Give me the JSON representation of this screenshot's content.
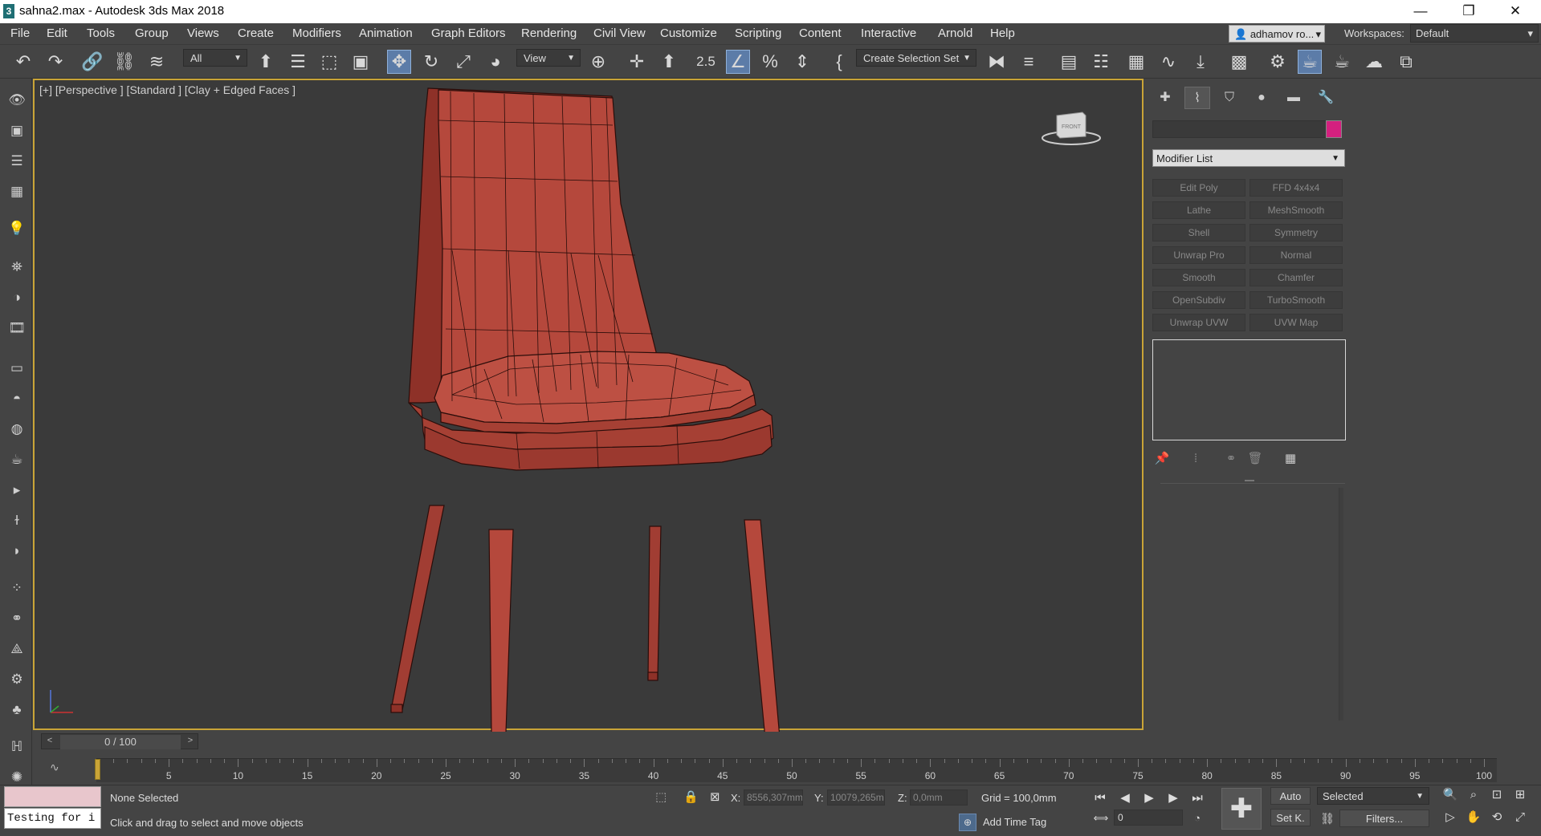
{
  "window": {
    "icon_text": "3",
    "title": "sahna2.max - Autodesk 3ds Max 2018",
    "minimize_glyph": "—",
    "restore_glyph": "❐",
    "close_glyph": "✕"
  },
  "menu": {
    "items": [
      "File",
      "Edit",
      "Tools",
      "Group",
      "Views",
      "Create",
      "Modifiers",
      "Animation",
      "Graph Editors",
      "Rendering",
      "Civil View",
      "Customize",
      "Scripting",
      "Content",
      "Interactive",
      "Arnold",
      "Help"
    ],
    "user": "adhamov ro...",
    "workspaces_label": "Workspaces:",
    "workspace_value": "Default"
  },
  "toolbar": {
    "selection_filter": "All",
    "ref_coord": "View",
    "selection_set": "Create Selection Set",
    "snap_value": "2.5"
  },
  "viewport": {
    "label": "[+] [Perspective ] [Standard ] [Clay + Edged Faces ]",
    "cube_label": "FRONT",
    "object_color": "#b5483c"
  },
  "command_panel": {
    "modifier_list": "Modifier List",
    "swatch_color": "#d4207f",
    "modifier_buttons": [
      "Edit Poly",
      "FFD 4x4x4",
      "Lathe",
      "MeshSmooth",
      "Shell",
      "Symmetry",
      "Unwrap Pro",
      "Normal",
      "Smooth",
      "Chamfer",
      "OpenSubdiv",
      "TurboSmooth",
      "Unwrap UVW",
      "UVW Map"
    ]
  },
  "timeline": {
    "label": "0 / 100",
    "prev": "<",
    "next": ">",
    "ticks": [
      "5",
      "10",
      "15",
      "20",
      "25",
      "30",
      "35",
      "40",
      "45",
      "50",
      "55",
      "60",
      "65",
      "70",
      "75",
      "80",
      "85",
      "90",
      "95",
      "100"
    ]
  },
  "status": {
    "maxscript_text": "Testing for i",
    "selection": "None Selected",
    "prompt": "Click and drag to select and move objects",
    "x_label": "X:",
    "x_value": "8556,307mm",
    "y_label": "Y:",
    "y_value": "10079,265mm",
    "z_label": "Z:",
    "z_value": "0,0mm",
    "grid": "Grid = 100,0mm",
    "add_time_tag": "Add Time Tag",
    "frame": "0",
    "auto_key": "Auto",
    "set_key": "Set K.",
    "key_mode": "Selected",
    "filters": "Filters..."
  }
}
